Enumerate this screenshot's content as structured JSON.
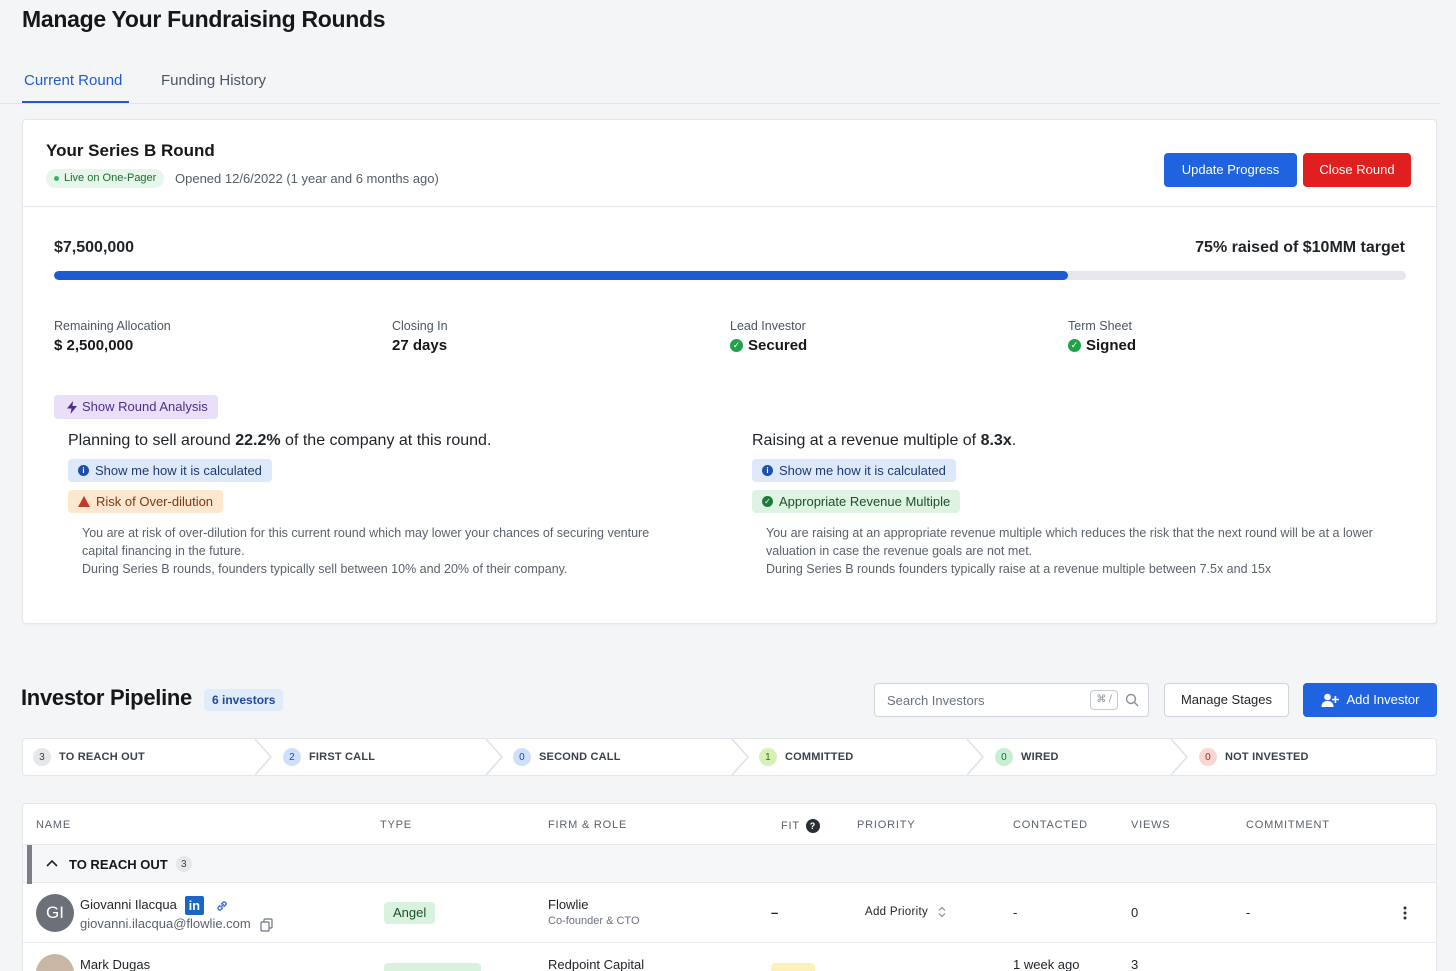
{
  "page": {
    "title": "Manage Your Fundraising Rounds",
    "tabs": [
      {
        "label": "Current Round",
        "active": true
      },
      {
        "label": "Funding History",
        "active": false
      }
    ]
  },
  "round": {
    "title": "Your Series B Round",
    "live_badge": "Live on One-Pager",
    "opened": "Opened 12/6/2022  (1 year and 6 months ago)",
    "update_button": "Update Progress",
    "close_button": "Close Round",
    "amount_raised": "$7,500,000",
    "target_text": "75% raised of $10MM target",
    "progress_fraction": 0.75,
    "stats": [
      {
        "label": "Remaining Allocation",
        "value": "$ 2,500,000",
        "check": false
      },
      {
        "label": "Closing In",
        "value": "27 days",
        "check": false
      },
      {
        "label": "Lead Investor",
        "value": "Secured",
        "check": true
      },
      {
        "label": "Term Sheet",
        "value": "Signed",
        "check": true
      }
    ],
    "analysis_button": "Show Round Analysis",
    "left": {
      "head_pre": "Planning to sell around ",
      "head_bold": "22.2%",
      "head_post": " of the company at this round.",
      "info_pill": "Show me how it is calculated",
      "status_pill": "Risk of Over-dilution",
      "para1": "You are at risk of over-dilution for this current round which may lower your chances of securing venture capital financing in the future.",
      "para2": "During Series B rounds, founders typically sell between 10% and 20% of their company."
    },
    "right": {
      "head_pre": "Raising at a revenue multiple of ",
      "head_bold": "8.3x",
      "head_post": ".",
      "info_pill": "Show me how it is calculated",
      "status_pill": "Appropriate Revenue Multiple",
      "para1": "You are raising at an appropriate revenue multiple which reduces the risk that the next round will be at a lower valuation in case the revenue goals are not met.",
      "para2": "During Series B rounds founders typically raise at a revenue multiple between 7.5x and 15x"
    }
  },
  "pipeline": {
    "title": "Investor Pipeline",
    "count_badge": "6 investors",
    "search_placeholder": "Search Investors",
    "shortcut": "⌘ /",
    "manage_button": "Manage Stages",
    "add_button": "Add Investor",
    "stages": [
      {
        "count": "3",
        "label": "TO REACH OUT",
        "color": "#e5e7ea",
        "text": "#3a414a"
      },
      {
        "count": "2",
        "label": "FIRST CALL",
        "color": "#cfe0fb",
        "text": "#1e4a9a"
      },
      {
        "count": "0",
        "label": "SECOND CALL",
        "color": "#cfe0fb",
        "text": "#1e4a9a"
      },
      {
        "count": "1",
        "label": "COMMITTED",
        "color": "#d6f0b8",
        "text": "#3d6b12"
      },
      {
        "count": "0",
        "label": "WIRED",
        "color": "#c9efd3",
        "text": "#1c6b34"
      },
      {
        "count": "0",
        "label": "NOT INVESTED",
        "color": "#fbd6d3",
        "text": "#9a2a22"
      }
    ],
    "columns": [
      "NAME",
      "TYPE",
      "FIRM & ROLE",
      "FIT",
      "PRIORITY",
      "CONTACTED",
      "VIEWS",
      "COMMITMENT"
    ],
    "group": {
      "label": "TO REACH OUT",
      "count": "3"
    },
    "rows": [
      {
        "initials": "GI",
        "name": "Giovanni Ilacqua",
        "email": "giovanni.ilacqua@flowlie.com",
        "type": "Angel",
        "firm": "Flowlie",
        "role": "Co-founder & CTO",
        "fit": "–",
        "priority": "Add Priority",
        "contacted": "-",
        "views": "0",
        "commitment": "-"
      },
      {
        "initials": "",
        "name": "Mark Dugas",
        "email": "",
        "type": "",
        "firm": "Redpoint Capital",
        "role": "",
        "fit": "",
        "priority": "",
        "contacted": "1 week ago",
        "views": "3",
        "commitment": ""
      }
    ]
  }
}
